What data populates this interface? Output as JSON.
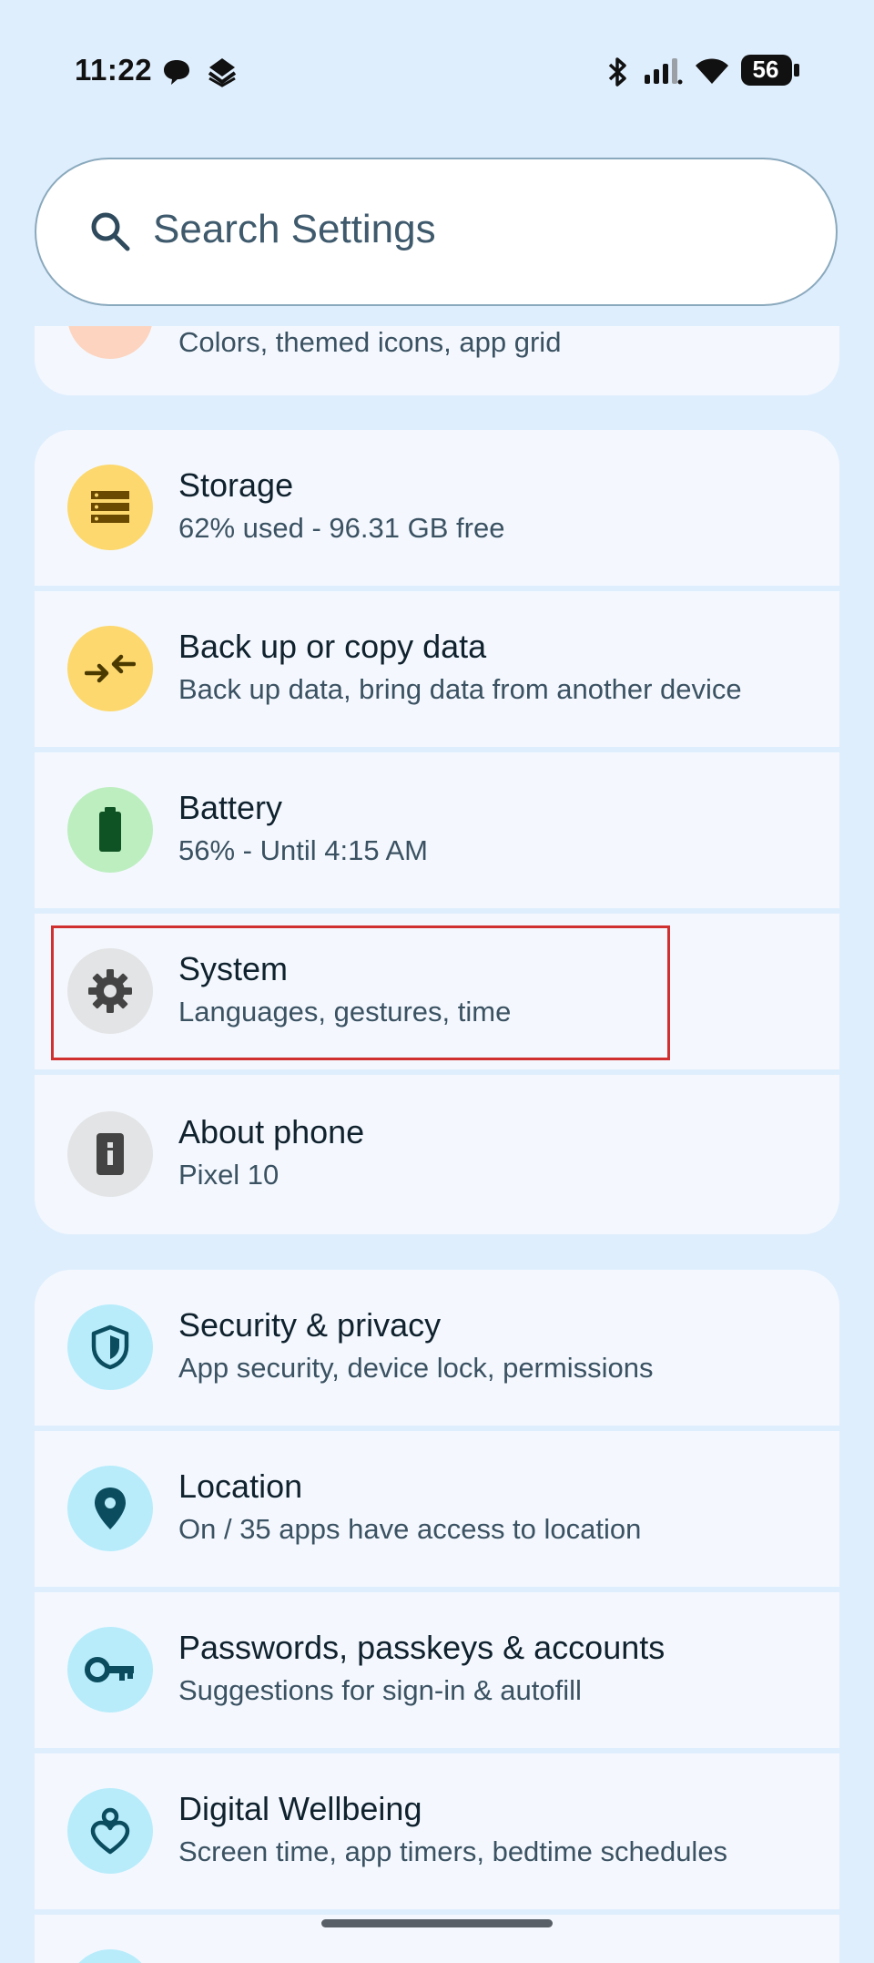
{
  "status_bar": {
    "time": "11:22",
    "battery_level": "56",
    "icons": [
      "chat-bubble-icon",
      "stacked-app-icon",
      "bluetooth-icon",
      "signal-icon",
      "wifi-icon",
      "battery-icon"
    ]
  },
  "search": {
    "placeholder": "Search Settings",
    "icon": "search-icon"
  },
  "groups": [
    {
      "items": [
        {
          "title": "",
          "subtitle": "Colors, themed icons, app grid",
          "icon": "palette-icon"
        }
      ]
    },
    {
      "items": [
        {
          "title": "Storage",
          "subtitle": "62% used - 96.31 GB free",
          "icon": "storage-icon",
          "icon_bg": "#fcd86e",
          "icon_fg": "#6a4a00"
        },
        {
          "title": "Back up or copy data",
          "subtitle": "Back up data, bring data from another device",
          "icon": "backup-icon",
          "icon_bg": "#fcd86e",
          "icon_fg": "#4b3a00"
        },
        {
          "title": "Battery",
          "subtitle": "56% - Until 4:15 AM",
          "icon": "battery-icon",
          "icon_bg": "#bdeec0",
          "icon_fg": "#0f5223"
        },
        {
          "title": "System",
          "subtitle": "Languages, gestures, time",
          "icon": "gear-icon",
          "icon_bg": "#e3e4e5",
          "icon_fg": "#444"
        },
        {
          "title": "About phone",
          "subtitle": "Pixel 10",
          "icon": "phone-info-icon",
          "icon_bg": "#e3e4e5",
          "icon_fg": "#444"
        }
      ]
    },
    {
      "items": [
        {
          "title": "Security & privacy",
          "subtitle": "App security, device lock, permissions",
          "icon": "shield-icon",
          "icon_bg": "#b8ecfb",
          "icon_fg": "#0b4d5e"
        },
        {
          "title": "Location",
          "subtitle": "On / 35 apps have access to location",
          "icon": "location-pin-icon",
          "icon_bg": "#b8ecfb",
          "icon_fg": "#0b4d5e"
        },
        {
          "title": "Passwords, passkeys & accounts",
          "subtitle": "Suggestions for sign-in & autofill",
          "icon": "key-icon",
          "icon_bg": "#b8ecfb",
          "icon_fg": "#0b4d5e"
        },
        {
          "title": "Digital Wellbeing",
          "subtitle": "Screen time, app timers, bedtime schedules",
          "icon": "wellbeing-icon",
          "icon_bg": "#b8ecfb",
          "icon_fg": "#0b4d5e"
        }
      ]
    }
  ],
  "colors": {
    "background": "#dfeefd",
    "card": "#f4f8fe",
    "highlight": "#d0302f"
  }
}
